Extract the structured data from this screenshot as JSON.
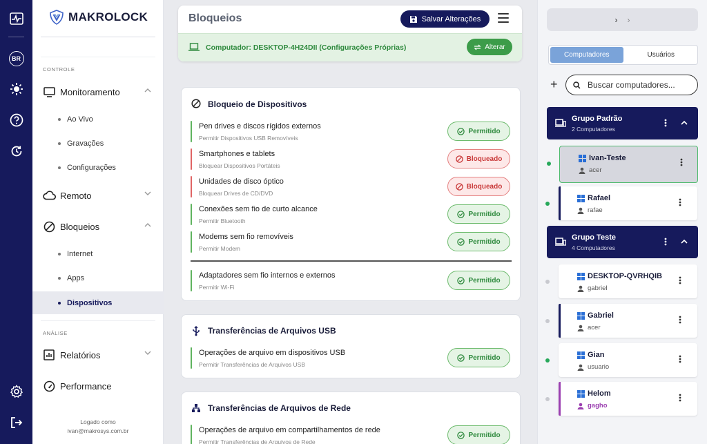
{
  "nav": {
    "logo_text": "MAKROLOCK",
    "rail_badge": "BR",
    "section_controle": "CONTROLE",
    "section_analise": "ANÁLISE",
    "monitoramento": "Monitoramento",
    "ao_vivo": "Ao Vivo",
    "gravacoes": "Gravações",
    "configuracoes": "Configurações",
    "remoto": "Remoto",
    "bloqueios": "Bloqueios",
    "internet": "Internet",
    "apps": "Apps",
    "dispositivos": "Dispositivos",
    "relatorios": "Relatórios",
    "performance": "Performance",
    "logged_label": "Logado como",
    "logged_user": "ivan@makrosys.com.br"
  },
  "header": {
    "title": "Bloqueios",
    "save_label": "Salvar Alterações",
    "computer_text": "Computador: DESKTOP-4H24DII (Configurações Próprias)",
    "alter_label": "Alterar"
  },
  "cards": {
    "devices": {
      "title": "Bloqueio de Dispositivos",
      "rules": [
        {
          "title": "Pen drives e discos rígidos externos",
          "sub": "Permitir Dispositivos USB Removíveis",
          "status": "Permitido"
        },
        {
          "title": "Smartphones e tablets",
          "sub": "Bloquear Dispositivos Portáteis",
          "status": "Bloqueado"
        },
        {
          "title": "Unidades de disco óptico",
          "sub": "Bloquear Drives de CD/DVD",
          "status": "Bloqueado"
        },
        {
          "title": "Conexões sem fio de curto alcance",
          "sub": "Permitir Bluetooth",
          "status": "Permitido"
        },
        {
          "title": "Modems sem fio removíveis",
          "sub": "Permitir Modem",
          "status": "Permitido"
        },
        {
          "title": "Adaptadores sem fio internos e externos",
          "sub": "Permitir Wi-Fi",
          "status": "Permitido"
        }
      ]
    },
    "usb": {
      "title": "Transferências de Arquivos USB",
      "rules": [
        {
          "title": "Operações de arquivo em dispositivos USB",
          "sub": "Permitir Transferências de Arquivos USB",
          "status": "Permitido"
        }
      ]
    },
    "network": {
      "title": "Transferências de Arquivos de Rede",
      "rules": [
        {
          "title": "Operações de arquivo em compartilhamentos de rede",
          "sub": "Permitir Transferências de Arquivos de Rede",
          "status": "Permitido"
        }
      ]
    }
  },
  "right": {
    "tab_computers": "Computadores",
    "tab_users": "Usuários",
    "search_placeholder": "Buscar computadores...",
    "groups": [
      {
        "name": "Grupo Padrão",
        "count": "2 Computadores"
      },
      {
        "name": "Grupo Teste",
        "count": "4 Computadores"
      }
    ],
    "computers": [
      {
        "name": "Ivan-Teste",
        "user": "acer",
        "online": true
      },
      {
        "name": "Rafael",
        "user": "rafae",
        "online": true
      },
      {
        "name": "DESKTOP-QVRHQIB",
        "user": "gabriel",
        "online": false
      },
      {
        "name": "Gabriel",
        "user": "acer",
        "online": false
      },
      {
        "name": "Gian",
        "user": "usuario",
        "online": true
      },
      {
        "name": "Helom",
        "user": "gagho",
        "online": false
      }
    ]
  },
  "colors": {
    "navy": "#161a5c",
    "green": "#3c9c49",
    "red": "#c93a3a",
    "purple": "#9b3fb0"
  },
  "icons": [
    "activity-icon",
    "sun-icon",
    "help-icon",
    "history-icon",
    "settings-icon",
    "logout-icon",
    "monitor-icon",
    "cloud-icon",
    "block-icon",
    "report-icon",
    "gauge-icon",
    "usb-icon",
    "network-icon",
    "windows-icon",
    "user-icon",
    "laptop-icon",
    "search-icon",
    "plus-icon"
  ]
}
